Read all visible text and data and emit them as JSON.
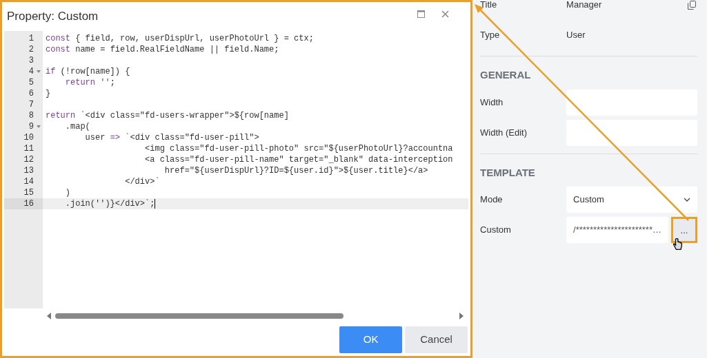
{
  "dialog": {
    "title": "Property: Custom",
    "ok_button": "OK",
    "cancel_button": "Cancel"
  },
  "editor": {
    "lines": [
      {
        "number": "1",
        "fold": false,
        "active": false,
        "tokens": [
          {
            "kind": "keyword",
            "text": "const"
          },
          {
            "kind": "plain",
            "text": " { field, row, userDispUrl, userPhotoUrl } = ctx;"
          }
        ]
      },
      {
        "number": "2",
        "fold": false,
        "active": false,
        "tokens": [
          {
            "kind": "keyword",
            "text": "const"
          },
          {
            "kind": "plain",
            "text": " name = field.RealFieldName || field.Name;"
          }
        ]
      },
      {
        "number": "3",
        "fold": false,
        "active": false
      },
      {
        "number": "4",
        "fold": true,
        "active": false,
        "tokens": [
          {
            "kind": "keyword",
            "text": "if"
          },
          {
            "kind": "plain",
            "text": " (!row[name]) {"
          }
        ]
      },
      {
        "number": "5",
        "fold": false,
        "active": false,
        "tokens": [
          {
            "kind": "keyword",
            "text": "    return"
          },
          {
            "kind": "string",
            "text": " ''"
          },
          {
            "kind": "plain",
            "text": ";"
          }
        ]
      },
      {
        "number": "6",
        "fold": false,
        "active": false,
        "tokens": [
          {
            "kind": "plain",
            "text": "}"
          }
        ]
      },
      {
        "number": "7",
        "fold": false,
        "active": false
      },
      {
        "number": "8",
        "fold": false,
        "active": false,
        "tokens": [
          {
            "kind": "keyword",
            "text": "return"
          },
          {
            "kind": "plain",
            "text": " `<div class=\"fd-users-wrapper\">${row[name]"
          }
        ]
      },
      {
        "number": "9",
        "fold": true,
        "active": false,
        "tokens": [
          {
            "kind": "plain",
            "text": "    .map("
          }
        ]
      },
      {
        "number": "10",
        "fold": false,
        "active": false,
        "tokens": [
          {
            "kind": "plain",
            "text": "        user "
          },
          {
            "kind": "keyword",
            "text": "=>"
          },
          {
            "kind": "plain",
            "text": " `<div class=\"fd-user-pill\">"
          }
        ]
      },
      {
        "number": "11",
        "fold": false,
        "active": false,
        "tokens": [
          {
            "kind": "plain",
            "text": "                    <img class=\"fd-user-pill-photo\" src=\"${userPhotoUrl}?accountna"
          }
        ]
      },
      {
        "number": "12",
        "fold": false,
        "active": false,
        "tokens": [
          {
            "kind": "plain",
            "text": "                    <a class=\"fd-user-pill-name\" target=\"_blank\" data-interception"
          }
        ]
      },
      {
        "number": "13",
        "fold": false,
        "active": false,
        "tokens": [
          {
            "kind": "plain",
            "text": "                        href=\"${userDispUrl}?ID=${user.id}\">${user.title}</a>"
          }
        ]
      },
      {
        "number": "14",
        "fold": false,
        "active": false,
        "tokens": [
          {
            "kind": "plain",
            "text": "                </div>`"
          }
        ]
      },
      {
        "number": "15",
        "fold": false,
        "active": false,
        "tokens": [
          {
            "kind": "plain",
            "text": "    )"
          }
        ]
      },
      {
        "number": "16",
        "fold": false,
        "active": true,
        "tokens": [
          {
            "kind": "plain",
            "text": "    .join('')}</div>`;"
          }
        ]
      }
    ]
  },
  "panel": {
    "sections": [
      {
        "fields": [
          {
            "kind": "text",
            "label": "Title",
            "value": "Manager",
            "copyable": true
          },
          {
            "kind": "text",
            "label": "Type",
            "value": "User",
            "copyable": false
          }
        ]
      },
      {
        "heading": "GENERAL",
        "fields": [
          {
            "kind": "input",
            "label": "Width"
          },
          {
            "kind": "input",
            "label": "Width (Edit)"
          }
        ]
      },
      {
        "heading": "TEMPLATE",
        "fields": [
          {
            "kind": "select",
            "label": "Mode",
            "value": "Custom"
          },
          {
            "kind": "editor",
            "label": "Custom",
            "value": "/**********************…",
            "button": "..."
          }
        ]
      }
    ]
  }
}
